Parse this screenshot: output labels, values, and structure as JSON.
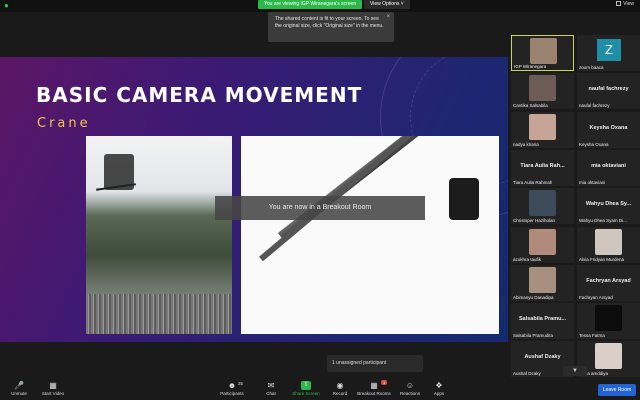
{
  "topbar": {
    "share_banner": "You are viewing IGP Wiranegara's screen",
    "view_options": "View Options ˅",
    "view_label": "View"
  },
  "tooltip": {
    "text": "The shared content is fit to your screen. To see the original size, click \"Original size\" in the menu.",
    "close": "×"
  },
  "slide": {
    "title": "BASIC CAMERA MOVEMENT",
    "subtitle": "Crane"
  },
  "breakout_notice": "You are now in a Breakout Room",
  "unassigned": "1 unassigned participant",
  "gallery": {
    "tiles": [
      {
        "name": "IGP Wiranegara",
        "big": "",
        "kind": "photo",
        "color": "#9a8470"
      },
      {
        "name": "zoom baaca",
        "big": "",
        "kind": "avatar",
        "letter": "Z"
      },
      {
        "name": "Cantika Salsabila",
        "big": "",
        "kind": "photo",
        "color": "#6d5b55"
      },
      {
        "name": "naufal fachrezy",
        "big": "naufal fachrezy",
        "kind": "text"
      },
      {
        "name": "nadya kharia",
        "big": "",
        "kind": "photo",
        "color": "#c7a596"
      },
      {
        "name": "Keysha Oxana",
        "big": "Keysha Oxana",
        "kind": "text"
      },
      {
        "name": "Tiara Aulia Rahmah",
        "big": "Tiara Aulia Rah...",
        "kind": "text"
      },
      {
        "name": "mia oktaviani",
        "big": "mia oktaviani",
        "kind": "text"
      },
      {
        "name": "Christoper Haziholan",
        "big": "",
        "kind": "photo",
        "color": "#3c4a5a"
      },
      {
        "name": "Wahyu Dhea Syam Di...",
        "big": "Wahyu Dhea Sy...",
        "kind": "text"
      },
      {
        "name": "azokhra taufik",
        "big": "",
        "kind": "photo",
        "color": "#b08a7a"
      },
      {
        "name": "Alvia Fridyan Murdena",
        "big": "",
        "kind": "photo",
        "color": "#cfc6c0"
      },
      {
        "name": "Abimanyu Danadipa",
        "big": "",
        "kind": "photo",
        "color": "#a89080"
      },
      {
        "name": "Fachryan Arsyad",
        "big": "Fachryan Arsyad",
        "kind": "text"
      },
      {
        "name": "Salsabila Pramudita",
        "big": "Salsabila Pramu...",
        "kind": "text"
      },
      {
        "name": "Tessa Fatma",
        "big": "",
        "kind": "dark"
      },
      {
        "name": "Aushaf Dzaky",
        "big": "Aushaf Dzaky",
        "kind": "text"
      },
      {
        "name": "fidela amddiya",
        "big": "",
        "kind": "photo",
        "color": "#d9cfc8"
      }
    ]
  },
  "toolbar": {
    "unmute": "Unmute",
    "start_video": "Start Video",
    "participants": "Participants",
    "participants_count": "35",
    "chat": "Chat",
    "share_screen": "Share Screen",
    "record": "Record",
    "breakout_rooms": "Breakout Rooms",
    "breakout_badge": "1",
    "reactions": "Reactions",
    "apps": "Apps",
    "leave": "Leave Room"
  },
  "colors": {
    "accent_green": "#2db84c",
    "leave_blue": "#2463d4",
    "active_border": "#c8d64a",
    "subtitle_gold": "#f2c94c"
  }
}
